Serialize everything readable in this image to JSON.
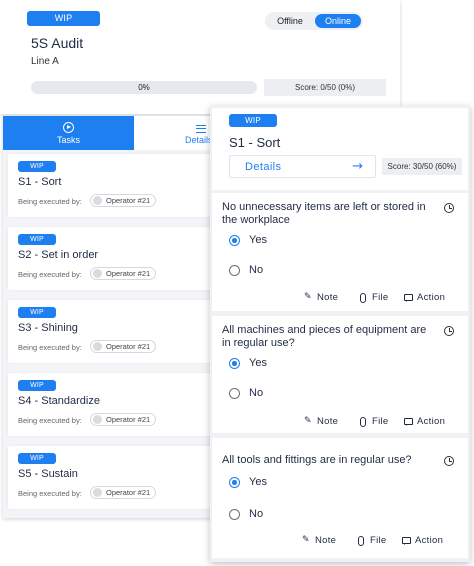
{
  "audit": {
    "status": "WIP",
    "mode_offline": "Offline",
    "mode_online": "Online",
    "title": "5S Audit",
    "line": "Line A",
    "progress_label": "0%",
    "progress_value": 0,
    "score": "Score: 0/50 (0%)"
  },
  "tabs": {
    "tasks": "Tasks",
    "details": "Details"
  },
  "tasks": [
    {
      "status": "WIP",
      "title": "S1 - Sort",
      "exec_label": "Being executed by:",
      "operator": "Operator #21"
    },
    {
      "status": "WIP",
      "title": "S2 - Set in order",
      "exec_label": "Being executed by:",
      "operator": "Operator #21"
    },
    {
      "status": "WIP",
      "title": "S3 - Shining",
      "exec_label": "Being executed by:",
      "operator": "Operator #21"
    },
    {
      "status": "WIP",
      "title": "S4 - Standardize",
      "exec_label": "Being executed by:",
      "operator": "Operator #21"
    },
    {
      "status": "WIP",
      "title": "S5 - Sustain",
      "exec_label": "Being executed by:",
      "operator": "Operator #21"
    }
  ],
  "task_detail": {
    "status": "WIP",
    "title": "S1 - Sort",
    "details_label": "Details",
    "score": "Score: 30/50 (60%)",
    "questions": [
      {
        "text": "No unnecessary items are left or stored in the workplace",
        "option_yes": "Yes",
        "option_no": "No",
        "selected": "Yes"
      },
      {
        "text": "All machines and pieces of equipment are in regular use?",
        "option_yes": "Yes",
        "option_no": "No",
        "selected": "Yes"
      },
      {
        "text": "All tools and fittings are in regular use?",
        "option_yes": "Yes",
        "option_no": "No",
        "selected": "Yes"
      }
    ],
    "actions": {
      "note": "Note",
      "file": "File",
      "action": "Action"
    }
  },
  "colors": {
    "accent": "#1e7ff0",
    "text": "#1f2a44",
    "panel": "#f0f1f4"
  }
}
